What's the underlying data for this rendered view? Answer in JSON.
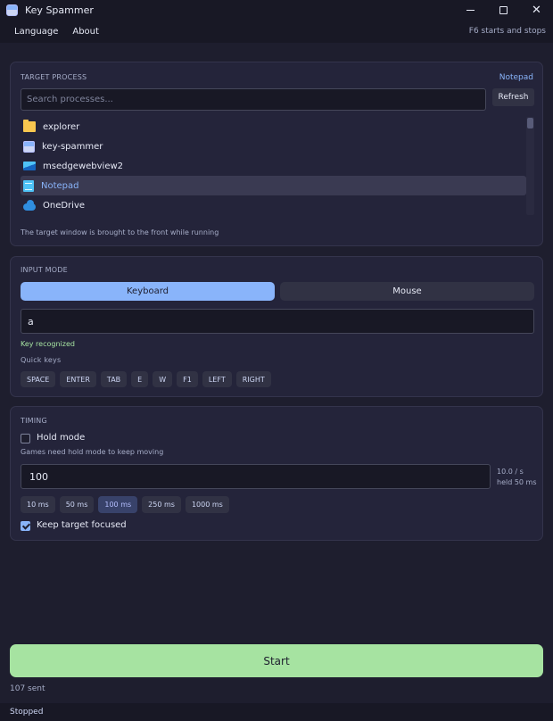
{
  "window": {
    "title": "Key Spammer",
    "icon": "app-icon",
    "controls": [
      "minimize-icon",
      "maximize-icon",
      "close-icon"
    ]
  },
  "menu": {
    "items": [
      "Language",
      "About"
    ],
    "hint": "F6 starts and stops"
  },
  "target": {
    "section_label": "TARGET PROCESS",
    "selected": "Notepad",
    "search_placeholder": "Search processes...",
    "search_value": "",
    "refresh_label": "Refresh",
    "processes": [
      {
        "name": "explorer",
        "icon": "folder-icon"
      },
      {
        "name": "key-spammer",
        "icon": "app-icon"
      },
      {
        "name": "msedgewebview2",
        "icon": "edge-icon"
      },
      {
        "name": "Notepad",
        "icon": "notepad-icon",
        "selected": true
      },
      {
        "name": "OneDrive",
        "icon": "cloud-icon"
      }
    ],
    "note": "The target window is brought to the front while running"
  },
  "input_mode": {
    "section_label": "INPUT MODE",
    "tabs": [
      "Keyboard",
      "Mouse"
    ],
    "active_tab": "Keyboard",
    "key_value": "a",
    "recognized": "Key recognized",
    "quick_keys_label": "Quick keys",
    "quick_keys": [
      "SPACE",
      "ENTER",
      "TAB",
      "E",
      "W",
      "F1",
      "LEFT",
      "RIGHT"
    ]
  },
  "timing": {
    "section_label": "TIMING",
    "hold_mode_label": "Hold mode",
    "hold_mode_checked": false,
    "hold_note": "Games need hold mode to keep moving",
    "interval_value": "100",
    "rate_line1": "10.0 / s",
    "rate_line2": "held 50 ms",
    "presets": [
      "10 ms",
      "50 ms",
      "100 ms",
      "250 ms",
      "1000 ms"
    ],
    "active_preset": "100 ms",
    "keep_focused_label": "Keep target focused",
    "keep_focused_checked": true
  },
  "start_label": "Start",
  "sent_count": "107 sent",
  "status": "Stopped",
  "colors": {
    "background": "#1e1e2e",
    "panel": "#24243a",
    "accent": "#89b4fa",
    "start": "#a6e3a1",
    "recognized": "#a6e3a1"
  }
}
